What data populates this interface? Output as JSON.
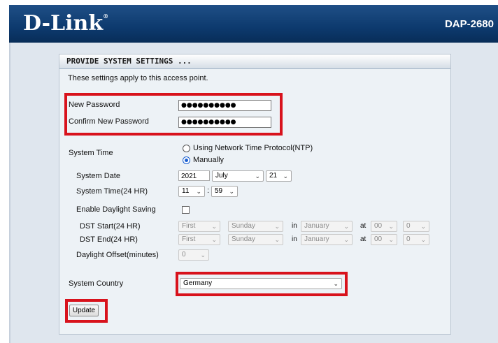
{
  "header": {
    "logo": "D-Link",
    "model": "DAP-2680"
  },
  "panel": {
    "title": "PROVIDE SYSTEM SETTINGS ...",
    "description": "These settings apply to this access point."
  },
  "password": {
    "new_label": "New Password",
    "new_value": "●●●●●●●●●●",
    "confirm_label": "Confirm New Password",
    "confirm_value": "●●●●●●●●●●"
  },
  "system_time": {
    "label": "System Time",
    "option_ntp": "Using Network Time Protocol(NTP)",
    "option_manual": "Manually",
    "selected": "Manually"
  },
  "system_date": {
    "label": "System Date",
    "year": "2021",
    "month": "July",
    "day": "21"
  },
  "system_time_24": {
    "label": "System Time(24 HR)",
    "hour": "11",
    "separator": ":",
    "minute": "59"
  },
  "daylight": {
    "label": "Enable Daylight Saving",
    "checked": false
  },
  "dst_start": {
    "label": "DST Start(24 HR)",
    "week": "First",
    "weekday": "Sunday",
    "in": "in",
    "month": "January",
    "at": "at",
    "hour": "00",
    "minute": "0"
  },
  "dst_end": {
    "label": "DST End(24 HR)",
    "week": "First",
    "weekday": "Sunday",
    "in": "in",
    "month": "January",
    "at": "at",
    "hour": "00",
    "minute": "0"
  },
  "daylight_offset": {
    "label": "Daylight Offset(minutes)",
    "value": "0"
  },
  "country": {
    "label": "System Country",
    "value": "Germany"
  },
  "actions": {
    "update": "Update"
  },
  "colors": {
    "header": "#0d3a6e",
    "highlight": "#d8121c",
    "panel": "#edf2f6"
  },
  "icons": {
    "dropdown": "chevron-down-icon"
  }
}
